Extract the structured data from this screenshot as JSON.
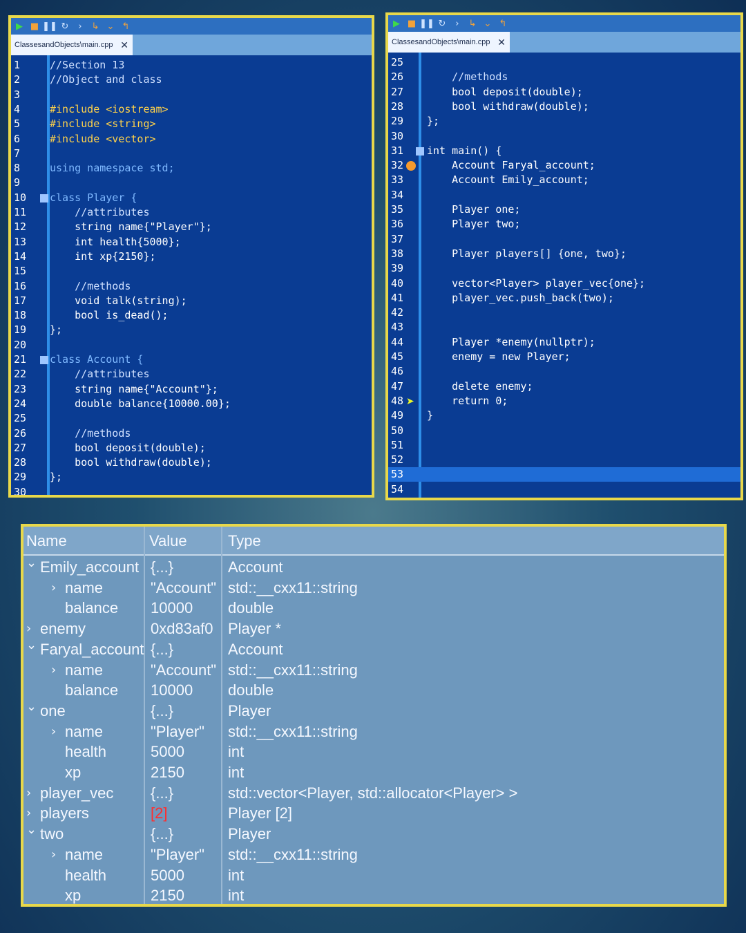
{
  "left_editor": {
    "tab_title": "ClassesandObjects\\main.cpp",
    "tab_close": "✕",
    "lines": [
      {
        "n": "1",
        "t": "//Section 13",
        "c": "cm"
      },
      {
        "n": "2",
        "t": "//Object and class",
        "c": "cm"
      },
      {
        "n": "3",
        "t": ""
      },
      {
        "n": "4",
        "t": "#include <iostream>",
        "c": "inc"
      },
      {
        "n": "5",
        "t": "#include <string>",
        "c": "inc"
      },
      {
        "n": "6",
        "t": "#include <vector>",
        "c": "inc"
      },
      {
        "n": "7",
        "t": ""
      },
      {
        "n": "8",
        "t": "using namespace std;",
        "c": "kw"
      },
      {
        "n": "9",
        "t": ""
      },
      {
        "n": "10",
        "t": "class Player {",
        "c": "kw"
      },
      {
        "n": "11",
        "t": "    //attributes",
        "c": "cm"
      },
      {
        "n": "12",
        "t": "    string name{\"Player\"};"
      },
      {
        "n": "13",
        "t": "    int health{5000};"
      },
      {
        "n": "14",
        "t": "    int xp{2150};"
      },
      {
        "n": "15",
        "t": ""
      },
      {
        "n": "16",
        "t": "    //methods",
        "c": "cm"
      },
      {
        "n": "17",
        "t": "    void talk(string);"
      },
      {
        "n": "18",
        "t": "    bool is_dead();"
      },
      {
        "n": "19",
        "t": "};"
      },
      {
        "n": "20",
        "t": ""
      },
      {
        "n": "21",
        "t": "class Account {",
        "c": "kw"
      },
      {
        "n": "22",
        "t": "    //attributes",
        "c": "cm"
      },
      {
        "n": "23",
        "t": "    string name{\"Account\"};"
      },
      {
        "n": "24",
        "t": "    double balance{10000.00};"
      },
      {
        "n": "25",
        "t": ""
      },
      {
        "n": "26",
        "t": "    //methods",
        "c": "cm"
      },
      {
        "n": "27",
        "t": "    bool deposit(double);"
      },
      {
        "n": "28",
        "t": "    bool withdraw(double);"
      },
      {
        "n": "29",
        "t": "};"
      },
      {
        "n": "30",
        "t": ""
      }
    ]
  },
  "right_editor": {
    "tab_title": "ClassesandObjects\\main.cpp",
    "tab_close": "✕",
    "lines": [
      {
        "n": "25",
        "t": ""
      },
      {
        "n": "26",
        "t": "    //methods",
        "c": "cm"
      },
      {
        "n": "27",
        "t": "    bool deposit(double);"
      },
      {
        "n": "28",
        "t": "    bool withdraw(double);"
      },
      {
        "n": "29",
        "t": "};"
      },
      {
        "n": "30",
        "t": ""
      },
      {
        "n": "31",
        "t": "int main() {"
      },
      {
        "n": "32",
        "t": "    Account Faryal_account;"
      },
      {
        "n": "33",
        "t": "    Account Emily_account;"
      },
      {
        "n": "34",
        "t": ""
      },
      {
        "n": "35",
        "t": "    Player one;"
      },
      {
        "n": "36",
        "t": "    Player two;"
      },
      {
        "n": "37",
        "t": ""
      },
      {
        "n": "38",
        "t": "    Player players[] {one, two};"
      },
      {
        "n": "39",
        "t": ""
      },
      {
        "n": "40",
        "t": "    vector<Player> player_vec{one};"
      },
      {
        "n": "41",
        "t": "    player_vec.push_back(two);"
      },
      {
        "n": "42",
        "t": ""
      },
      {
        "n": "43",
        "t": ""
      },
      {
        "n": "44",
        "t": "    Player *enemy(nullptr);"
      },
      {
        "n": "45",
        "t": "    enemy = new Player;"
      },
      {
        "n": "46",
        "t": ""
      },
      {
        "n": "47",
        "t": "    delete enemy;"
      },
      {
        "n": "48",
        "t": "    return 0;"
      },
      {
        "n": "49",
        "t": "}"
      },
      {
        "n": "50",
        "t": ""
      },
      {
        "n": "51",
        "t": ""
      },
      {
        "n": "52",
        "t": ""
      },
      {
        "n": "53",
        "t": ""
      },
      {
        "n": "54",
        "t": ""
      }
    ]
  },
  "watch": {
    "headers": {
      "name": "Name",
      "value": "Value",
      "type": "Type"
    },
    "rows": [
      {
        "indent": 0,
        "caret": "down",
        "name": "Emily_account",
        "value": "{...}",
        "type": "Account"
      },
      {
        "indent": 1,
        "caret": "right",
        "name": "name",
        "value": "\"Account\"",
        "type": "std::__cxx11::string"
      },
      {
        "indent": 1,
        "caret": "",
        "name": "balance",
        "value": "10000",
        "type": "double"
      },
      {
        "indent": 0,
        "caret": "right",
        "name": "enemy",
        "value": "0xd83af0",
        "type": "Player *"
      },
      {
        "indent": 0,
        "caret": "down",
        "name": "Faryal_account",
        "value": "{...}",
        "type": "Account"
      },
      {
        "indent": 1,
        "caret": "right",
        "name": "name",
        "value": "\"Account\"",
        "type": "std::__cxx11::string"
      },
      {
        "indent": 1,
        "caret": "",
        "name": "balance",
        "value": "10000",
        "type": "double"
      },
      {
        "indent": 0,
        "caret": "down",
        "name": "one",
        "value": "{...}",
        "type": "Player"
      },
      {
        "indent": 1,
        "caret": "right",
        "name": "name",
        "value": "\"Player\"",
        "type": "std::__cxx11::string"
      },
      {
        "indent": 1,
        "caret": "",
        "name": "health",
        "value": "5000",
        "type": "int"
      },
      {
        "indent": 1,
        "caret": "",
        "name": "xp",
        "value": "2150",
        "type": "int"
      },
      {
        "indent": 0,
        "caret": "right",
        "name": "player_vec",
        "value": "{...}",
        "type": "std::vector<Player, std::allocator<Player> >"
      },
      {
        "indent": 0,
        "caret": "right",
        "name": "players",
        "value": "[2]",
        "type": "Player [2]",
        "value_color": "#ff2e2e"
      },
      {
        "indent": 0,
        "caret": "down",
        "name": "two",
        "value": "{...}",
        "type": "Player"
      },
      {
        "indent": 1,
        "caret": "right",
        "name": "name",
        "value": "\"Player\"",
        "type": "std::__cxx11::string"
      },
      {
        "indent": 1,
        "caret": "",
        "name": "health",
        "value": "5000",
        "type": "int"
      },
      {
        "indent": 1,
        "caret": "",
        "name": "xp",
        "value": "2150",
        "type": "int"
      }
    ]
  },
  "icons": {
    "toolbar": [
      "play-icon",
      "stop-icon",
      "pause-icon",
      "restart-icon",
      "step-over-icon",
      "step-into-icon",
      "step-out-icon",
      "step-return-icon"
    ]
  }
}
